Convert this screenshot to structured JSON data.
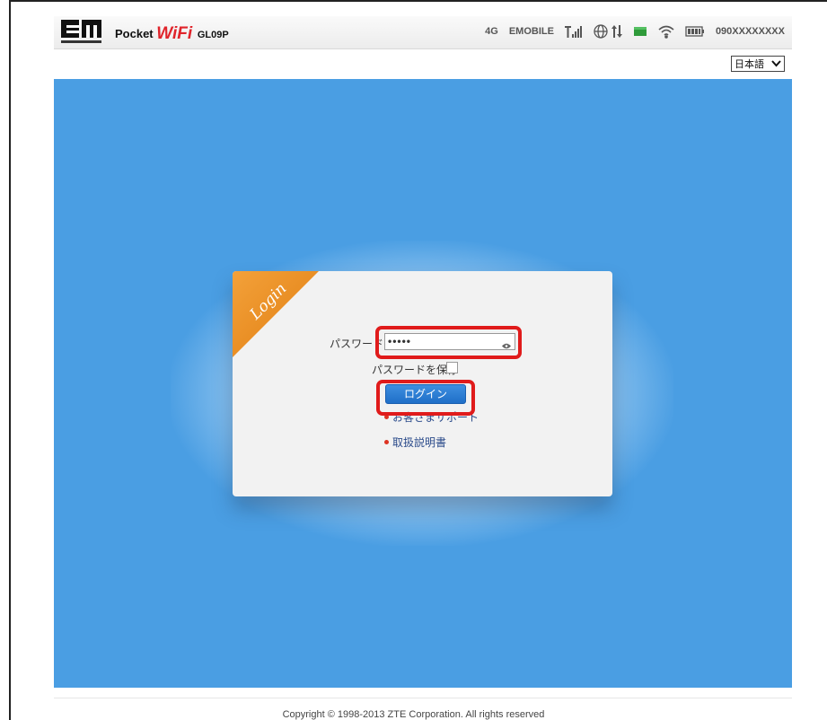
{
  "header": {
    "brand_prefix": "Pocket",
    "brand_wifi": "WiFi",
    "model": "GL09P",
    "status": {
      "network_type": "4G",
      "carrier": "EMOBILE",
      "phone_number": "090XXXXXXXX"
    }
  },
  "language": {
    "selected": "日本語"
  },
  "login": {
    "ribbon_text": "Login",
    "password_label": "パスワード",
    "password_value": "•••••",
    "remember_label": "パスワードを保存",
    "remember_checked": false,
    "button_label": "ログイン",
    "links": [
      {
        "label": "お客さまサポート"
      },
      {
        "label": "取扱説明書"
      }
    ]
  },
  "footer": {
    "copyright": "Copyright © 1998-2013 ZTE Corporation. All rights reserved"
  },
  "colors": {
    "background": "#4a9ee3",
    "highlight": "#e01b1b",
    "ribbon": "#e88a1c",
    "brand_red": "#e0242b"
  },
  "icons": [
    "em-logo",
    "signal-icon",
    "globe-icon",
    "data-arrows-icon",
    "sim-icon",
    "wifi-icon",
    "battery-icon",
    "eye-icon",
    "chevron-down-icon"
  ]
}
